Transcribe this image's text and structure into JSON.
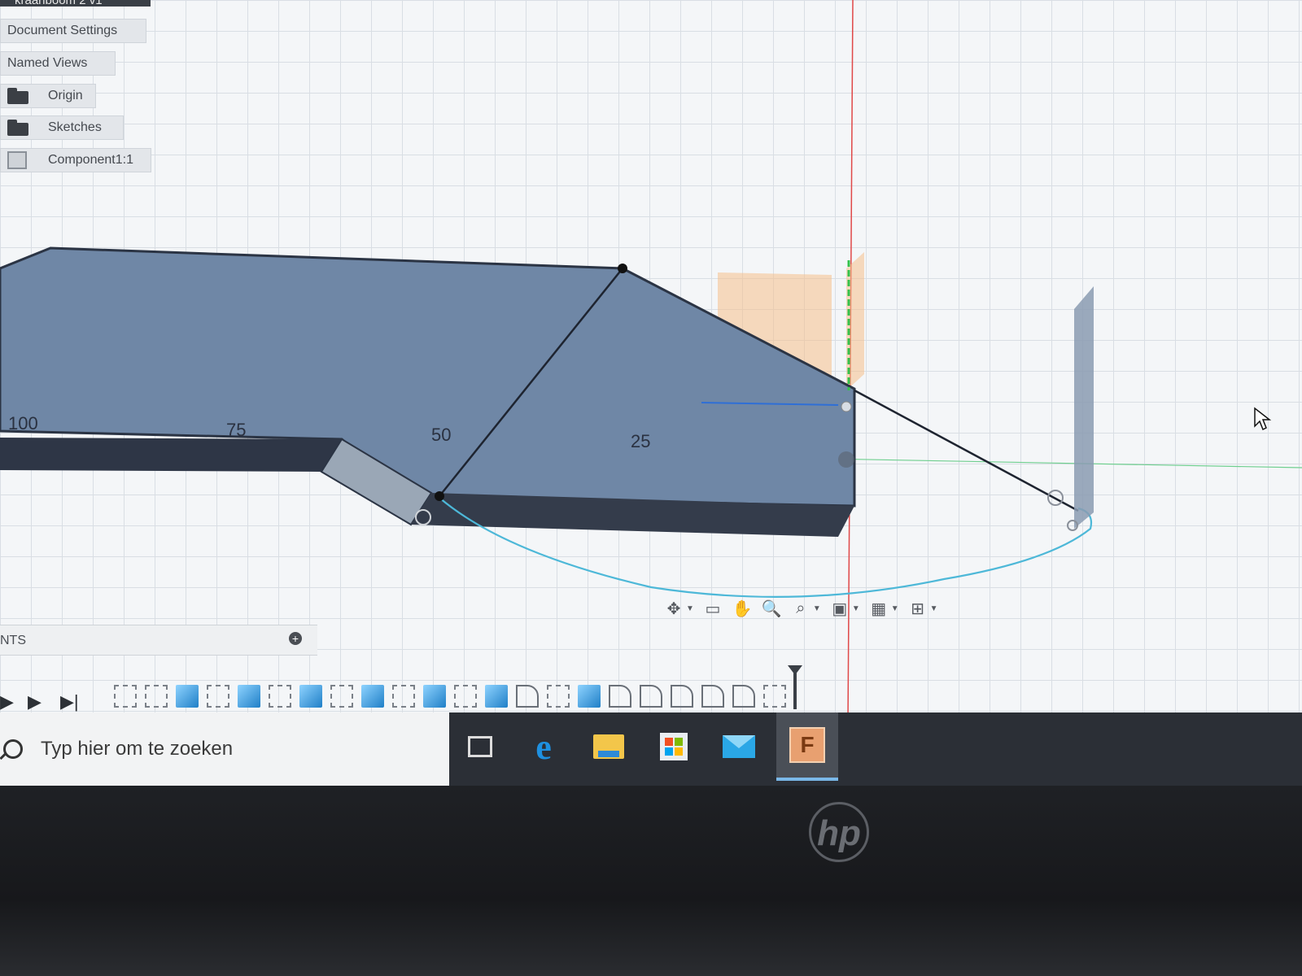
{
  "document": {
    "title": "kraanboom 2 v1"
  },
  "browser": {
    "items": [
      {
        "label": "Document Settings",
        "icon": "none"
      },
      {
        "label": "Named Views",
        "icon": "none"
      },
      {
        "label": "Origin",
        "icon": "folder-icon"
      },
      {
        "label": "Sketches",
        "icon": "folder-icon"
      },
      {
        "label": "Component1:1",
        "icon": "component-icon"
      }
    ]
  },
  "viewport": {
    "ruler_labels": [
      "100",
      "75",
      "50",
      "25"
    ],
    "colors": {
      "body_fill": "#6f87a6",
      "body_edge": "#2b3444",
      "sketch_arc": "#4db8d8",
      "y_axis": "#e04848",
      "x_axis": "#6fcf8f",
      "selection": "#f6c08a"
    }
  },
  "components_panel": {
    "label": "NTS"
  },
  "navbar": {
    "tools": [
      "orbit-icon",
      "look-at-icon",
      "pan-icon",
      "zoom-icon",
      "fit-icon",
      "display-settings-icon",
      "grid-icon",
      "viewports-icon"
    ]
  },
  "timeline": {
    "features": [
      "sketch",
      "sketch",
      "extrude",
      "sketch",
      "extrude",
      "sketch",
      "extrude",
      "sketch",
      "extrude",
      "sketch",
      "extrude",
      "sketch",
      "extrude",
      "fillet-corner",
      "sketch",
      "extrude",
      "fillet",
      "fillet",
      "fillet",
      "fillet",
      "fillet",
      "sketch"
    ]
  },
  "taskbar": {
    "search_placeholder": "Typ hier om te zoeken",
    "apps": [
      "task-view-icon",
      "edge-icon",
      "file-explorer-icon",
      "store-icon",
      "mail-icon",
      "fusion-icon"
    ],
    "fusion_letter": "F"
  },
  "laptop": {
    "brand": "hp"
  }
}
